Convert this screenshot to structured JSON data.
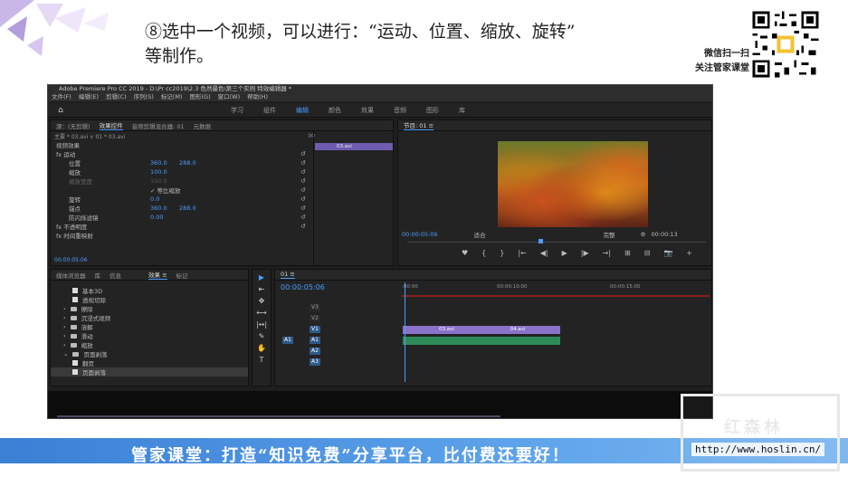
{
  "slide": {
    "heading_line1": "⑧选中一个视频，可以进行：“运动、位置、缩放、旋转”",
    "heading_line2": "等制作。",
    "qr_label_line1": "微信扫一扫",
    "qr_label_line2": "关注管家课堂"
  },
  "premiere": {
    "title": "Adobe Premiere Pro CC 2019 - D:\\Pr cc2019\\2.3 色然最色\\第三个实例 特效编辑器 *",
    "menu": [
      "文件(F)",
      "编辑(E)",
      "剪辑(C)",
      "序列(S)",
      "标记(M)",
      "图形(G)",
      "窗口(W)",
      "帮助(H)"
    ],
    "workspaces": [
      "学习",
      "组件",
      "编辑",
      "颜色",
      "效果",
      "音频",
      "图形",
      "库"
    ],
    "active_workspace": "编辑",
    "effect_controls": {
      "tabs": [
        "源：(无剪辑)",
        "效果控件",
        "音频剪辑混合器: 01",
        "元数据"
      ],
      "active_tab": "效果控件",
      "breadcrumb": "主要 * 03.avi  ∨  01 * 03.avi",
      "ruler_start": "00",
      "clip_name": "03.avi",
      "section": "视频效果",
      "rows": [
        {
          "label": "fx 运动",
          "v1": "",
          "v2": ""
        },
        {
          "label": "位置",
          "v1": "360.0",
          "v2": "288.0"
        },
        {
          "label": "缩放",
          "v1": "100.0",
          "v2": ""
        },
        {
          "label": "缩放宽度",
          "v1": "100.0",
          "v2": ""
        },
        {
          "label": "",
          "v1": "✓ 等比缩放",
          "v2": ""
        },
        {
          "label": "旋转",
          "v1": "0.0",
          "v2": ""
        },
        {
          "label": "锚点",
          "v1": "360.0",
          "v2": "288.0"
        },
        {
          "label": "防闪烁滤镜",
          "v1": "0.00",
          "v2": ""
        },
        {
          "label": "fx 不透明度",
          "v1": "",
          "v2": ""
        },
        {
          "label": "fx 时间重映射",
          "v1": "",
          "v2": ""
        }
      ],
      "timecode": "00:00:05:06"
    },
    "program_monitor": {
      "tab": "节目: 01 ≡",
      "timecode": "00:00:05:06",
      "fit": "适合",
      "quality": "完整",
      "end_timecode": "00:00:13",
      "controls": [
        "♥",
        "{",
        "}",
        "|←",
        "◀|",
        "▶",
        "|▶",
        "→|",
        "⊞",
        "⊟",
        "📷",
        "+"
      ]
    },
    "effects_panel": {
      "tabs": [
        "媒体浏览器",
        "库",
        "信息",
        "效果 ≡",
        "标记"
      ],
      "active_tab": "效果 ≡",
      "items": [
        {
          "label": "基本3D",
          "kind": "fx"
        },
        {
          "label": "透视切除",
          "kind": "fx"
        },
        {
          "label": "擦除",
          "kind": "folder"
        },
        {
          "label": "沉浸式视频",
          "kind": "folder"
        },
        {
          "label": "溶解",
          "kind": "folder"
        },
        {
          "label": "滑动",
          "kind": "folder"
        },
        {
          "label": "缩放",
          "kind": "folder"
        },
        {
          "label": "页面剥落",
          "kind": "folder"
        },
        {
          "label": "翻页",
          "kind": "fx"
        },
        {
          "label": "页面剥落",
          "kind": "fx",
          "selected": true
        }
      ]
    },
    "tools": [
      "▶",
      "⇤",
      "✥",
      "⟷",
      "|↔|",
      "✎",
      "✋",
      "T"
    ],
    "timeline": {
      "tab": "01 ≡",
      "timecode": "00:00:05:06",
      "ruler": [
        ":00:00",
        "00:00:10:00",
        "00:00:15:00"
      ],
      "tracks": [
        {
          "name": "V3",
          "type": "video",
          "active": false
        },
        {
          "name": "V2",
          "type": "video",
          "active": false
        },
        {
          "name": "V1",
          "type": "video",
          "active": true
        },
        {
          "name": "A1",
          "type": "audio",
          "active": true,
          "src": "A1"
        },
        {
          "name": "A2",
          "type": "audio",
          "active": false
        },
        {
          "name": "A3",
          "type": "audio",
          "active": false
        }
      ],
      "clip1": "03.avi",
      "clip2": "04.avi"
    }
  },
  "banner": {
    "text": "管家课堂：打造“知识免费”分享平台，比付费还要好！",
    "watermark_logo": "红森林",
    "watermark_url": "http://www.hoslin.cn/"
  }
}
